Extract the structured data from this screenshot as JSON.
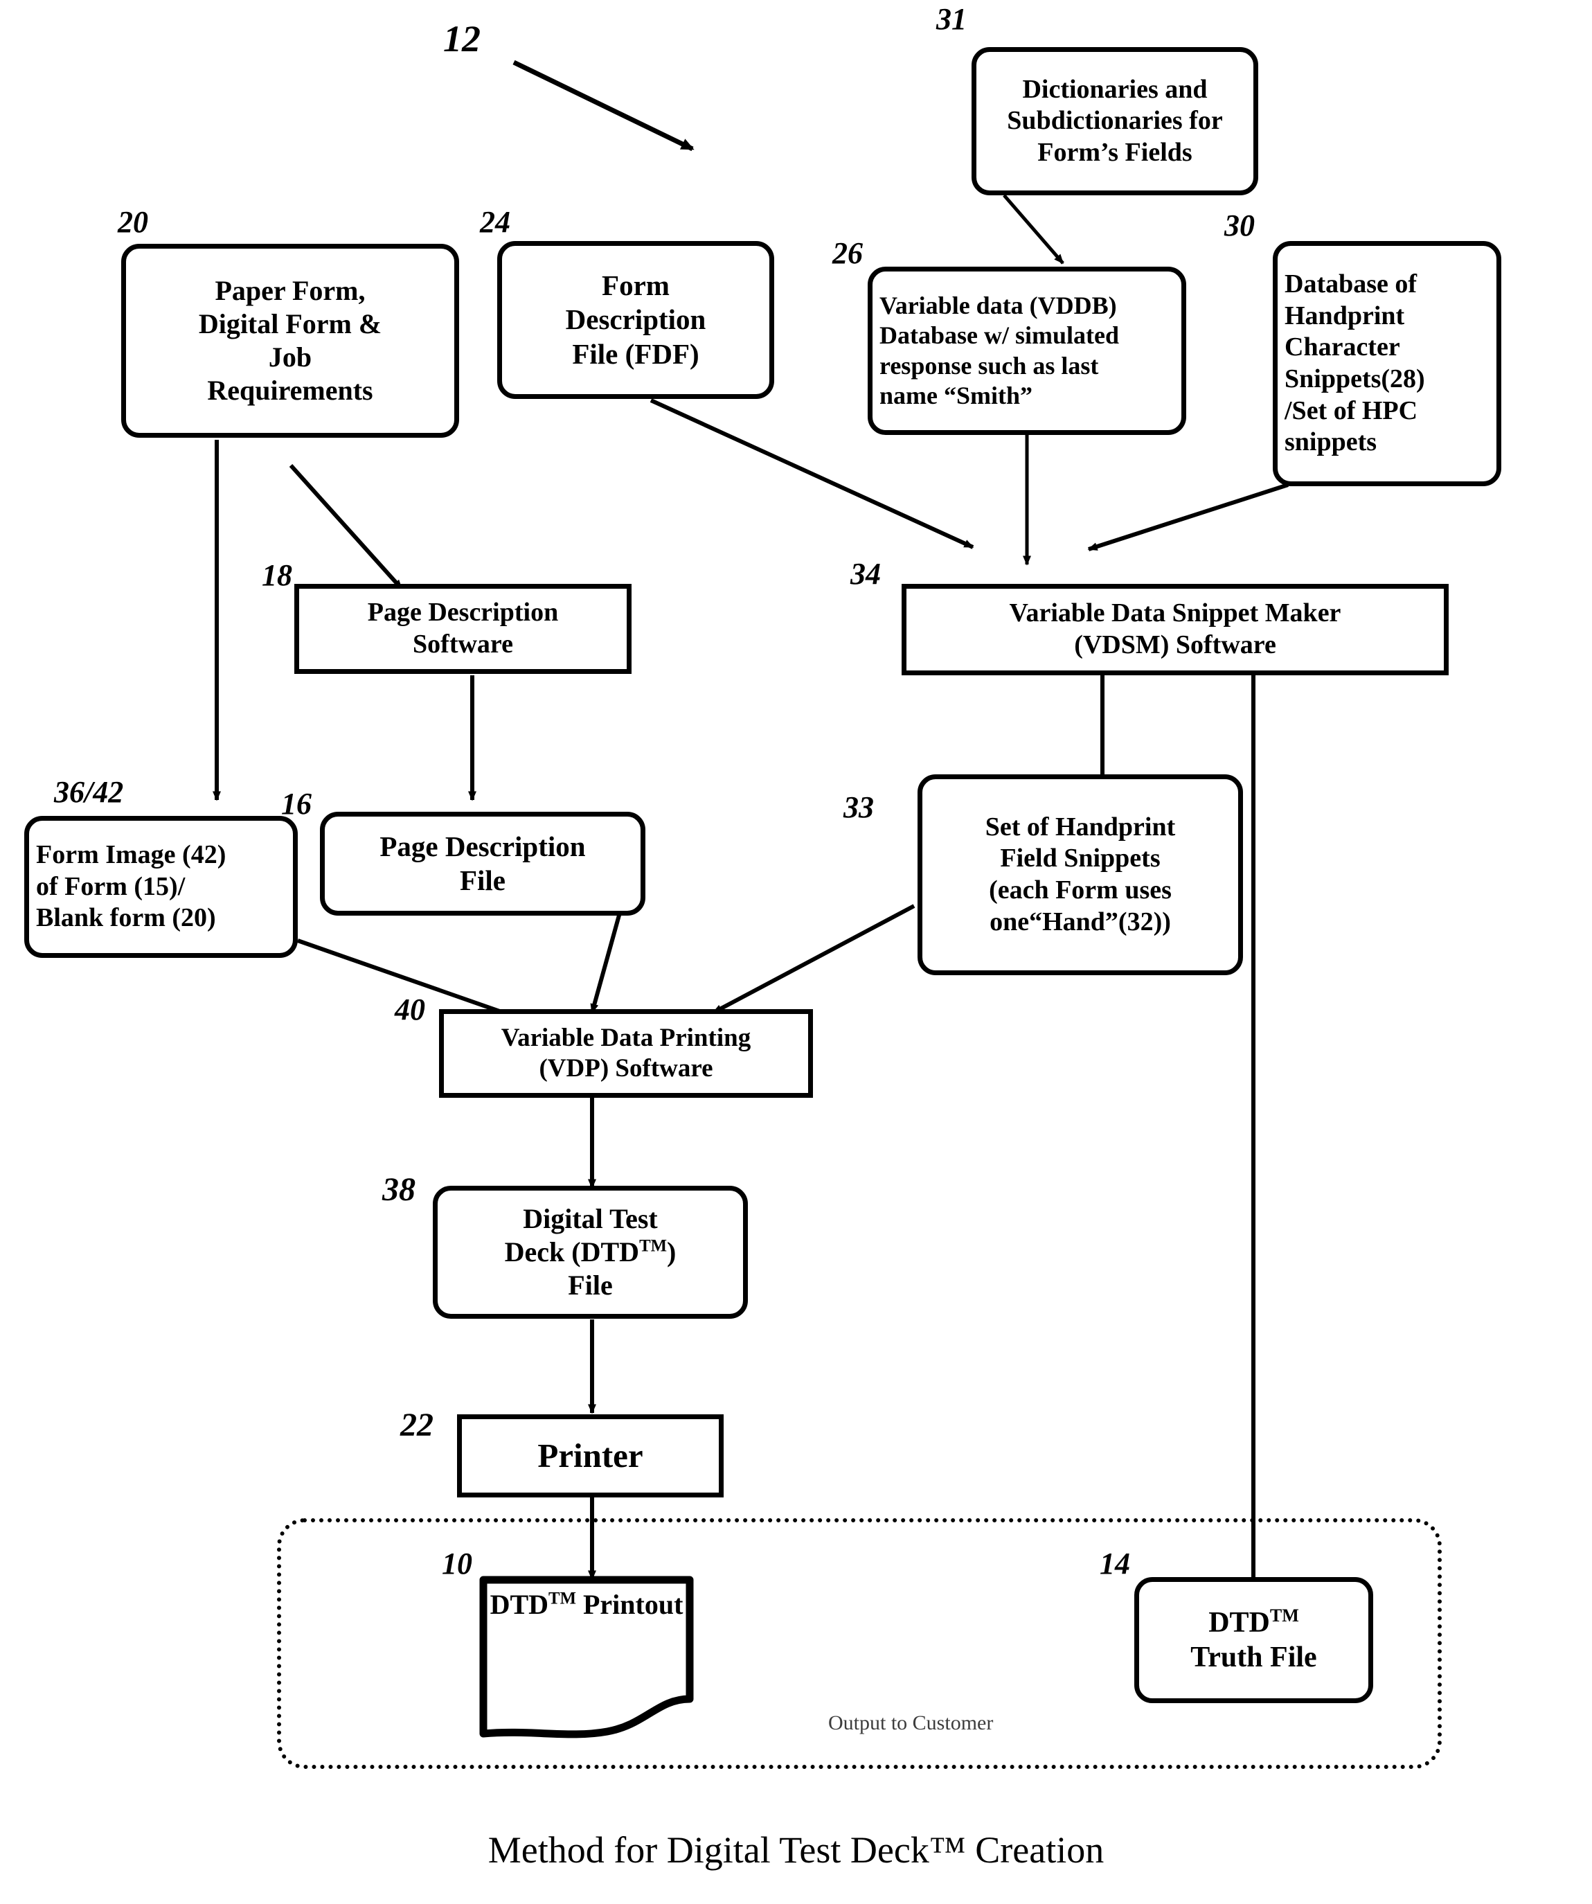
{
  "figure": {
    "caption": "Method for Digital Test Deck™ Creation",
    "figure_ref": "12",
    "output_region_label": "Output to Customer"
  },
  "nodes": {
    "dictionaries": {
      "ref": "31",
      "lines": [
        "Dictionaries and",
        "Subdictionaries for",
        "Form’s Fields"
      ]
    },
    "paper_form": {
      "ref": "20",
      "lines": [
        "Paper Form,",
        "Digital Form &",
        "Job",
        "Requirements"
      ]
    },
    "fdf": {
      "ref": "24",
      "lines": [
        "Form",
        "Description",
        "File (FDF)"
      ]
    },
    "vddb": {
      "ref": "26",
      "lines": [
        "Variable data (VDDB)",
        "Database w/ simulated",
        "response such as last",
        "name “Smith”"
      ]
    },
    "hpc_database": {
      "ref": "30",
      "lines": [
        "Database of",
        "Handprint",
        "Character",
        "Snippets(28)",
        "/Set of HPC",
        "snippets"
      ]
    },
    "page_description_software": {
      "ref": "18",
      "lines": [
        "Page Description",
        "Software"
      ]
    },
    "vdsm": {
      "ref": "34",
      "lines": [
        "Variable Data Snippet Maker",
        "(VDSM) Software"
      ]
    },
    "form_image": {
      "ref": "36/42",
      "lines": [
        "Form Image (42)",
        "of Form (15)/",
        "Blank form (20)"
      ]
    },
    "page_description_file": {
      "ref": "16",
      "lines": [
        "Page Description",
        "File"
      ]
    },
    "handprint_snippets": {
      "ref": "33",
      "lines": [
        "Set of Handprint",
        "Field Snippets",
        "(each Form uses",
        "one“Hand”(32))"
      ]
    },
    "vdp": {
      "ref": "40",
      "lines": [
        "Variable Data Printing",
        "(VDP) Software"
      ]
    },
    "dtd_file": {
      "ref": "38",
      "line1": "Digital Test",
      "line2_pre": "Deck (DTD",
      "line2_tm": "TM",
      "line2_post": ")",
      "line3": "File"
    },
    "printer": {
      "ref": "22",
      "lines": [
        "Printer"
      ]
    },
    "dtd_printout": {
      "ref": "10",
      "line1_pre": "DTD",
      "line1_tm": "TM",
      "line2": "Printout"
    },
    "dtd_truth_file": {
      "ref": "14",
      "line1_pre": "DTD",
      "line1_tm": "TM",
      "line2": "Truth File"
    }
  },
  "colors": {
    "ink": "#000000",
    "paper": "#ffffff",
    "faded_label": "#3d3d3d"
  }
}
